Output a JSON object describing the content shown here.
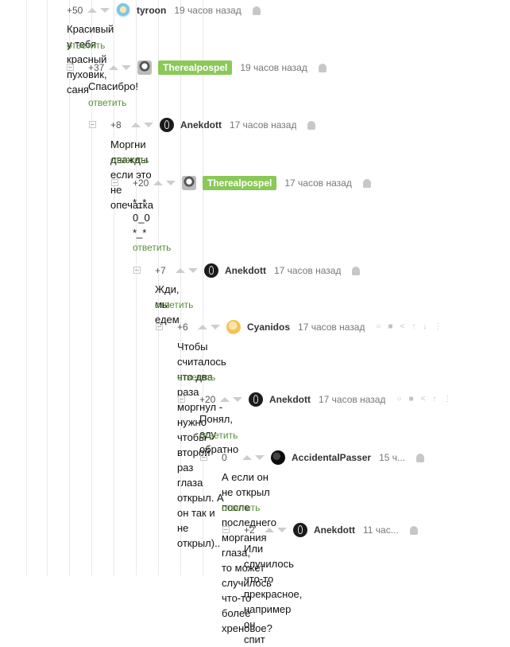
{
  "comments": [
    {
      "rating": "+50",
      "author": "tyroon",
      "time": "19 часов назад",
      "lines": [
        "Красивый у тебя красный пуховик, саня"
      ],
      "reply": "ответить"
    },
    {
      "rating": "+37",
      "author": "Therealpospel",
      "time": "19 часов назад",
      "lines": [
        "Спасибро!"
      ],
      "reply": "ответить"
    },
    {
      "rating": "+8",
      "author": "Anekdott",
      "time": "17 часов назад",
      "lines": [
        "Моргни дважды если это не опечатка"
      ],
      "reply": "ответить"
    },
    {
      "rating": "+20",
      "author": "Therealpospel",
      "time": "17 часов назад",
      "lines": [
        "*_*",
        "0_0",
        "*_*"
      ],
      "reply": "ответить"
    },
    {
      "rating": "+7",
      "author": "Anekdott",
      "time": "17 часов назад",
      "lines": [
        "Жди, мы едем"
      ],
      "reply": "ответить"
    },
    {
      "rating": "+6",
      "author": "Cyanidos",
      "time": "17 часов назад",
      "lines": [
        "Чтобы считалось что два раза моргнул - нужно чтобы второй раз",
        "глаза открыл. А он так и не открыл).."
      ],
      "reply": "ответить"
    },
    {
      "rating": "+20",
      "author": "Anekdott",
      "time": "17 часов назад",
      "lines": [
        "Понял, еду обратно"
      ],
      "reply": "ответить"
    },
    {
      "rating": "0",
      "author": "AccidentalPasser",
      "time": "15 ч...",
      "lines": [
        "А если он не открыл после последнего моргания глаза,",
        "то может случилось что-то более хреновое?"
      ],
      "reply": "ответить"
    },
    {
      "rating": "+2",
      "author": "Anekdott",
      "time": "11 час...",
      "lines": [
        "Или случилось что-то прекрасное, например он",
        "спит"
      ]
    }
  ],
  "colors": {
    "accent": "#5a8f3a",
    "badge": "#8ac858"
  },
  "icons": {
    "platform": "android-icon",
    "link": "link-icon",
    "save": "save-icon",
    "share": "share-icon",
    "up": "to-top-icon",
    "down": "to-bottom-icon",
    "more": "more-icon"
  }
}
